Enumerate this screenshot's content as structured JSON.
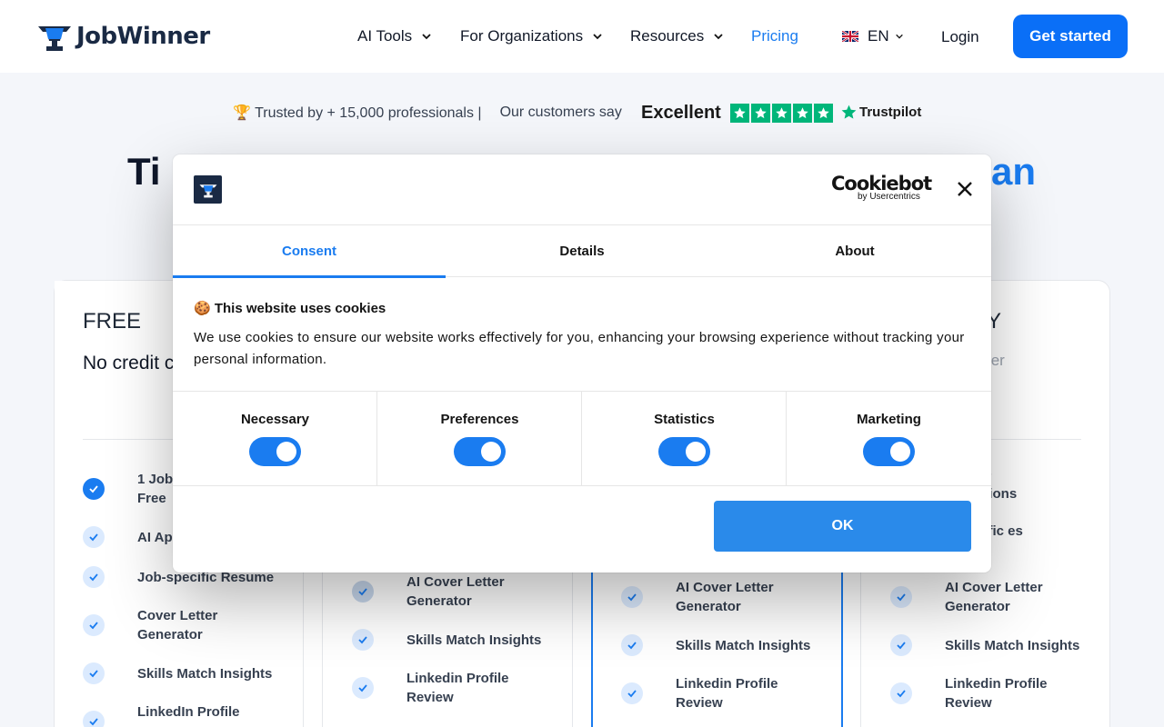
{
  "header": {
    "brand": "JobWinner",
    "nav": [
      {
        "label": "AI Tools"
      },
      {
        "label": "For Organizations"
      },
      {
        "label": "Resources"
      },
      {
        "label": "Pricing"
      }
    ],
    "language": "EN",
    "login": "Login",
    "cta": "Get started"
  },
  "trust": {
    "trusted": "🏆 Trusted by + 15,000 professionals |",
    "customers": "Our customers say",
    "rating": "Excellent",
    "trustpilot": "Trustpilot"
  },
  "headline": {
    "left": "Ti",
    "right": "an"
  },
  "pricing": {
    "free": {
      "title": "FREE",
      "subtitle": "No credit c required",
      "features": [
        "1 Job Free",
        "AI App",
        "Job-specific Resume",
        "Cover Letter Generator",
        "Skills Match Insights",
        "LinkedIn Profile"
      ]
    },
    "col2": {
      "features": [
        "AI Cover Letter Generator",
        "Skills Match Insights",
        "Linkedin Profile Review"
      ]
    },
    "col3": {
      "features": [
        "AI Cover Letter Generator",
        "Skills Match Insights",
        "Linkedin Profile Review"
      ]
    },
    "col4": {
      "title_fragment": "Y",
      "subtitle_fragment": "ter",
      "features": [
        "00 ations",
        "cific es",
        "AI Cover Letter Generator",
        "Skills Match Insights",
        "Linkedin Profile Review"
      ]
    }
  },
  "cookie_dialog": {
    "provider": "Cookiebot",
    "provider_sub": "by Usercentrics",
    "tabs": [
      "Consent",
      "Details",
      "About"
    ],
    "active_tab": "Consent",
    "title": "🍪 This website uses cookies",
    "body": "We use cookies to ensure our website works effectively for you, enhancing your browsing experience without tracking your personal information.",
    "toggles": [
      {
        "label": "Necessary",
        "on": true
      },
      {
        "label": "Preferences",
        "on": true
      },
      {
        "label": "Statistics",
        "on": true
      },
      {
        "label": "Marketing",
        "on": true
      }
    ],
    "ok": "OK"
  },
  "colors": {
    "accent": "#1a7cf0",
    "cta": "#0a6ff7",
    "trustpilot_green": "#00b67a",
    "ok_button": "#2a8aea",
    "brand_dark": "#1a2a44"
  }
}
